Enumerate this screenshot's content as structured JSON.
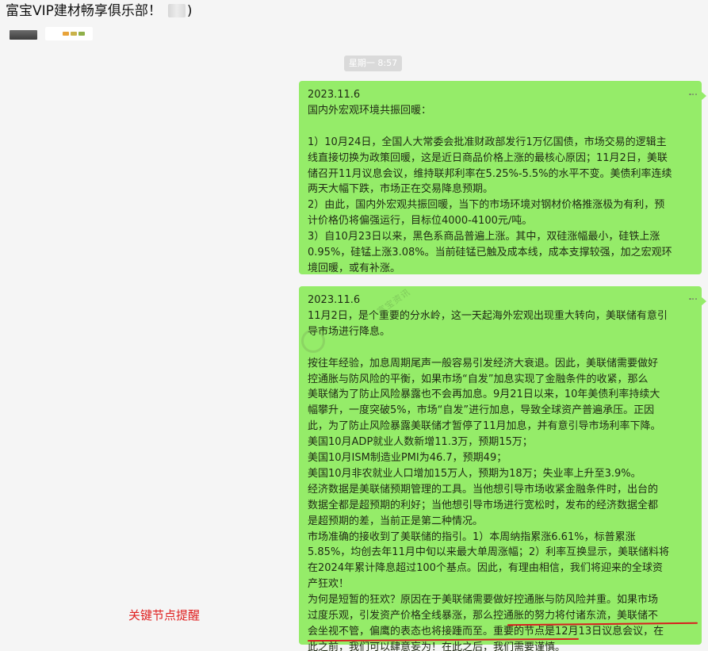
{
  "window": {
    "title": "富宝VIP建材畅享俱乐部！",
    "title_suffix": ")"
  },
  "timestamp": "星期一 8:57",
  "messages": [
    {
      "lines": [
        "2023.11.6",
        "国内外宏观环境共振回暖：",
        "",
        "1）10月24日，全国人大常委会批准财政部发行1万亿国债，市场交易的逻辑主",
        "线直接切换为政策回暖，这是近日商品价格上涨的最核心原因；11月2日，美联",
        "储召开11月议息会议，维持联邦利率在5.25%-5.5%的水平不变。美债利率连续",
        "两天大幅下跌，市场正在交易降息预期。",
        "2）由此，国内外宏观共振回暖，当下的市场环境对钢材价格推涨极为有利，预",
        "计价格仍将偏强运行，目标位4000-4100元/吨。",
        "3）自10月23日以来，黑色系商品普遍上涨。其中，双硅涨幅最小，硅铁上涨",
        "0.95%，硅锰上涨3.08%。当前硅锰已触及成本线，成本支撑较强，加之宏观环",
        "境回暖，或有补涨。"
      ]
    },
    {
      "lines": [
        "2023.11.6",
        "11月2日，是个重要的分水岭，这一天起海外宏观出现重大转向，美联储有意引",
        "导市场进行降息。",
        "",
        "按往年经验，加息周期尾声一般容易引发经济大衰退。因此，美联储需要做好",
        "控通胀与防风险的平衡，如果市场“自发”加息实现了金融条件的收紧，那么",
        "美联储为了防止风险暴露也不会再加息。9月21日以来，10年美债利率持续大",
        "幅攀升，一度突破5%，市场“自发”进行加息，导致全球资产普遍承压。正因",
        "此，为了防止风险暴露美联储才暂停了11月加息，并有意引导市场利率下降。",
        "美国10月ADP就业人数新增11.3万，预期15万；",
        "美国10月ISM制造业PMI为46.7，预期49；",
        "美国10月非农就业人口增加15万人，预期为18万；失业率上升至3.9%。",
        "经济数据是美联储预期管理的工具。当他想引导市场收紧金融条件时，出台的",
        "数据全都是超预期的利好；当他想引导市场进行宽松时，发布的经济数据全都",
        "是超预期的差，当前正是第二种情况。",
        "市场准确的接收到了美联储的指引。1）本周纳指累涨6.61%，标普累涨",
        "5.85%，均创去年11月中旬以来最大单周涨幅；2）利率互换显示，美联储料将",
        "在2024年累计降息超过100个基点。因此，有理由相信，我们将迎来的全球资",
        "产狂欢！",
        "为何是短暂的狂欢？原因在于美联储需要做好控通胀与防风险并重。如果市场",
        "过度乐观，引发资产价格全线暴涨，那么控通胀的努力将付诸东流，美联储不",
        "会坐视不管，偏鹰的表态也将接踵而至。重要的节点是12月13日议息会议，在",
        "此之前，我们可以肆意妄为！在此之后，我们需要谨慎。"
      ],
      "watermark": "富宝资讯"
    }
  ],
  "annotation": {
    "label": "关键节点提醒",
    "color": "#e02020"
  },
  "colors": {
    "bubble": "#95ec69",
    "background": "#f5f5f5",
    "underline": "#d81e1e"
  },
  "icons": [
    "more-icon"
  ]
}
